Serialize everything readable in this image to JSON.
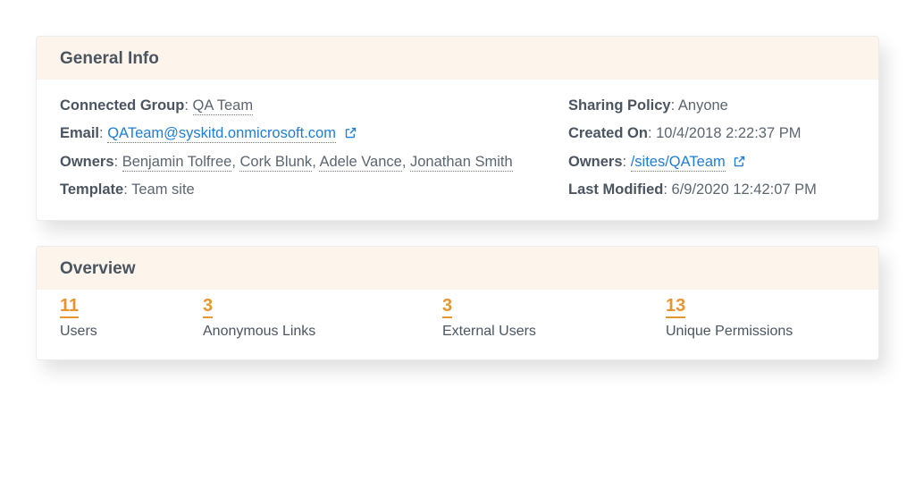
{
  "general": {
    "title": "General Info",
    "labels": {
      "connected_group": "Connected Group",
      "email": "Email",
      "owners": "Owners",
      "template": "Template",
      "sharing_policy": "Sharing Policy",
      "created_on": "Created On",
      "owners_url": "Owners",
      "last_modified": "Last Modified"
    },
    "connected_group": "QA Team",
    "email": "QATeam@syskitd.onmicrosoft.com",
    "owners": [
      "Benjamin Tolfree",
      "Cork Blunk",
      "Adele Vance",
      "Jonathan Smith"
    ],
    "template": "Team site",
    "sharing_policy": "Anyone",
    "created_on": "10/4/2018 2:22:37 PM",
    "owners_url": "/sites/QATeam",
    "last_modified": "6/9/2020 12:42:07 PM"
  },
  "overview": {
    "title": "Overview",
    "stats": [
      {
        "value": "11",
        "label": "Users"
      },
      {
        "value": "3",
        "label": "Anonymous Links"
      },
      {
        "value": "3",
        "label": "External Users"
      },
      {
        "value": "13",
        "label": "Unique Permissions"
      }
    ]
  }
}
